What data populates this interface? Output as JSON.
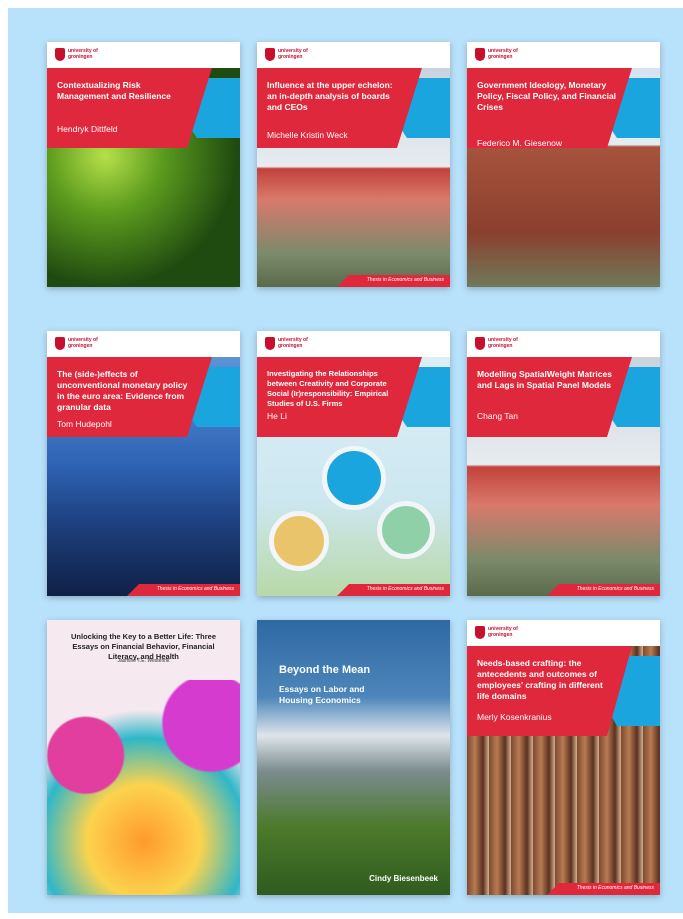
{
  "logo_text": "university of groningen",
  "series_label": "Thesis in Economics and Business",
  "colors": {
    "board_bg": "#b8e1fb",
    "red": "#e0283c",
    "cyan": "#1ba5de"
  },
  "books": [
    {
      "title": "Contextualizing Risk Management and Resilience",
      "author": "Hendryk Dittfeld"
    },
    {
      "title": "Influence at the upper echelon: an in-depth analysis of boards and CEOs",
      "author": "Michelle Kristin Weck"
    },
    {
      "title": "Government Ideology, Monetary Policy, Fiscal Policy, and Financial Crises",
      "author": "Federico M. Giesenow"
    },
    {
      "title": "The (side-)effects of unconventional monetary policy in the euro area: Evidence from granular data",
      "author": "Tom Hudepohl"
    },
    {
      "title": "Investigating the Relationships between Creativity and Corporate Social (Ir)responsibility: Empirical Studies of U.S. Firms",
      "author": "He Li"
    },
    {
      "title": "Modelling SpatialWeight Matrices and Lags in Spatial Panel Models",
      "author": "Chang Tan"
    },
    {
      "title": "Unlocking the Key to a Better Life: Three Essays on Financial Behavior, Financial Literacy, and Health",
      "author": "Jasmine T.E. Westerink"
    },
    {
      "title": "Beyond the Mean",
      "subtitle": "Essays on Labor and Housing Economics",
      "author": "Cindy Biesenbeek"
    },
    {
      "title": "Needs-based crafting: the antecedents and outcomes of employees' crafting in different life domains",
      "author": "Merly Kosenkranius"
    }
  ]
}
